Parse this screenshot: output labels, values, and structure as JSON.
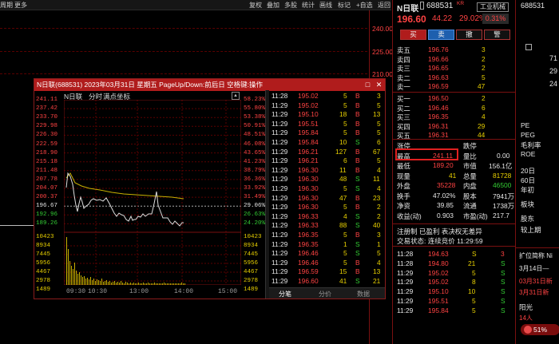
{
  "topbar": {
    "left1": "周期",
    "left2": "更多",
    "buttons": [
      "复权",
      "叠加",
      "多股",
      "统计",
      "画线",
      "标记",
      "+自选",
      "返回"
    ]
  },
  "bg_axis": {
    "labels": [
      "240.00",
      "225.00",
      "210.00"
    ]
  },
  "popup": {
    "title": "N日联(688531) 2023年03月31日 星期五 PageUp/Down:前后日 空格键:操作",
    "header": {
      "name": "N日联",
      "tab1": "分时",
      "tab2": "满点坐标"
    },
    "price_left": [
      "241.11",
      "237.42",
      "233.70",
      "229.98",
      "226.30",
      "222.59",
      "218.90",
      "215.18",
      "211.48",
      "207.78",
      "204.07",
      "200.37",
      "196.67",
      "192.96",
      "189.26"
    ],
    "price_right": [
      "58.23%",
      "55.80%",
      "53.38%",
      "50.91%",
      "48.51%",
      "46.08%",
      "43.65%",
      "41.23%",
      "38.79%",
      "36.36%",
      "33.92%",
      "31.49%",
      "29.06%",
      "26.63%",
      "24.20%"
    ],
    "vol_left": [
      "10423",
      "8934",
      "7445",
      "5956",
      "4467",
      "2978",
      "1489"
    ],
    "vol_right": [
      "10423",
      "8934",
      "7445",
      "5956",
      "4467",
      "2978",
      "1489"
    ],
    "times": [
      "09:30",
      "10:30",
      "13:00",
      "14:00",
      "15:00"
    ],
    "ticks": [
      [
        "11:28",
        "195.02",
        "5",
        "B",
        "3"
      ],
      [
        "11:29",
        "195.02",
        "5",
        "B",
        "5"
      ],
      [
        "11:29",
        "195.10",
        "18",
        "B",
        "13"
      ],
      [
        "11:29",
        "195.51",
        "5",
        "B",
        "5"
      ],
      [
        "11:29",
        "195.84",
        "5",
        "B",
        "5"
      ],
      [
        "11:29",
        "195.84",
        "10",
        "S",
        "6"
      ],
      [
        "11:29",
        "196.21",
        "127",
        "B",
        "67"
      ],
      [
        "11:29",
        "196.21",
        "6",
        "B",
        "5"
      ],
      [
        "11:29",
        "196.30",
        "11",
        "B",
        "4"
      ],
      [
        "11:29",
        "196.30",
        "48",
        "S",
        "11"
      ],
      [
        "11:29",
        "196.30",
        "5",
        "S",
        "4"
      ],
      [
        "11:29",
        "196.30",
        "47",
        "B",
        "23"
      ],
      [
        "11:29",
        "196.30",
        "5",
        "B",
        "2"
      ],
      [
        "11:29",
        "196.33",
        "4",
        "S",
        "2"
      ],
      [
        "11:29",
        "196.33",
        "88",
        "S",
        "40"
      ],
      [
        "11:29",
        "196.35",
        "5",
        "B",
        "3"
      ],
      [
        "11:29",
        "196.35",
        "1",
        "S",
        "1"
      ],
      [
        "11:29",
        "196.46",
        "5",
        "S",
        "5"
      ],
      [
        "11:29",
        "196.46",
        "5",
        "B",
        "4"
      ],
      [
        "11:29",
        "196.59",
        "15",
        "B",
        "13"
      ],
      [
        "11:29",
        "196.60",
        "41",
        "S",
        "21"
      ]
    ],
    "tabs": [
      "分笔",
      "分价",
      "数据"
    ]
  },
  "stock": {
    "name": "N日联",
    "code": "688531",
    "badge": "KR",
    "sector": "工业机械",
    "price": "196.60",
    "change": "44.22",
    "pct": "29.02%",
    "ratio": "0.31%"
  },
  "buttons": [
    "买",
    "卖",
    "撤",
    "警"
  ],
  "sells": [
    [
      "卖五",
      "196.76",
      "3"
    ],
    [
      "卖四",
      "196.66",
      "2"
    ],
    [
      "卖三",
      "196.65",
      "2"
    ],
    [
      "卖二",
      "196.63",
      "5"
    ],
    [
      "卖一",
      "196.59",
      "47"
    ]
  ],
  "buys": [
    [
      "买一",
      "196.50",
      "2"
    ],
    [
      "买二",
      "196.46",
      "6"
    ],
    [
      "买三",
      "196.35",
      "4"
    ],
    [
      "买四",
      "196.31",
      "29"
    ],
    [
      "买五",
      "196.31",
      "44"
    ]
  ],
  "stats": [
    [
      "涨停",
      "",
      "跌停",
      ""
    ],
    [
      "最高",
      "241.11",
      "量比",
      "0.00"
    ],
    [
      "最低",
      "189.20",
      "市值",
      "156.1亿"
    ],
    [
      "现量",
      "41",
      "总量",
      "81728"
    ],
    [
      "外盘",
      "35228",
      "内盘",
      "46500"
    ],
    [
      "换手",
      "47.02%",
      "股本",
      "7941万"
    ],
    [
      "净资",
      "39.85",
      "流通",
      "1738万"
    ],
    [
      "收益(动)",
      "0.903",
      "市盈(动)",
      "217.7"
    ]
  ],
  "notice": "注册制 已盈利 表决权无差异",
  "status": "交易状态: 连续竞价 11:29:59",
  "trades": [
    [
      "11:28",
      "194.63",
      "S",
      "3"
    ],
    [
      "11:28",
      "194.80",
      "21",
      "S"
    ],
    [
      "11:29",
      "195.02",
      "5",
      "S"
    ],
    [
      "11:29",
      "195.02",
      "8",
      "S"
    ],
    [
      "11:29",
      "195.10",
      "10",
      "S"
    ],
    [
      "11:29",
      "195.51",
      "5",
      "S"
    ],
    [
      "11:29",
      "195.84",
      "5",
      "S"
    ]
  ],
  "far": {
    "code": "688531",
    "items": [
      "PE",
      "PEG",
      "毛利率",
      "ROE"
    ],
    "labels": [
      "20日",
      "60日",
      "年初",
      "板块",
      "股东",
      "较上期"
    ],
    "nums": [
      "71",
      "29",
      "24"
    ],
    "news": [
      "扩位简称 Ni",
      "3月14日—",
      "03月31日新",
      "3月31日新"
    ],
    "sun": "阳光",
    "pct": "51%",
    "count": "14人"
  }
}
